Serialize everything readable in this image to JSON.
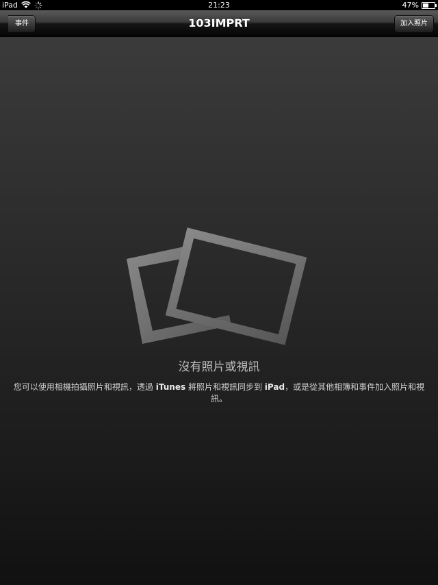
{
  "status_bar": {
    "device": "iPad",
    "time": "21:23",
    "battery_percent": "47%",
    "battery_level": 0.47
  },
  "nav": {
    "back_label": "事件",
    "title": "103IMPRT",
    "add_label": "加入照片"
  },
  "empty_state": {
    "icon": "photos-icon",
    "title": "沒有照片或視訊",
    "desc_part1": "您可以使用相機拍攝照片和視訊，透過",
    "desc_itunes": "iTunes",
    "desc_part2": "將照片和視訊同步到",
    "desc_ipad": "iPad",
    "desc_part3": "，或是從其他相簿和事件加入照片和視訊。"
  }
}
